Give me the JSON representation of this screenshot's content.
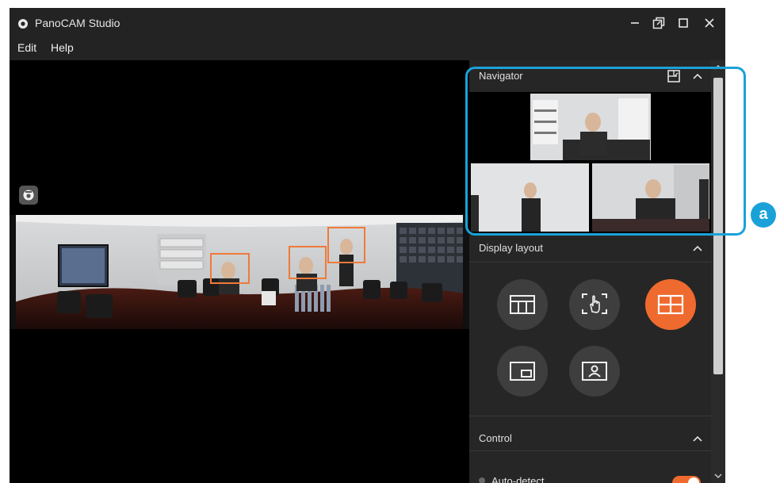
{
  "window": {
    "title": "PanoCAM Studio",
    "controls": [
      "minimize-icon",
      "restore-icon",
      "maximize-icon",
      "close-icon"
    ]
  },
  "menu": {
    "items": [
      {
        "label": "Edit"
      },
      {
        "label": "Help"
      }
    ]
  },
  "panel": {
    "navigator": {
      "title": "Navigator",
      "icons": [
        "fit-icon",
        "chevron-up-icon"
      ]
    },
    "display_layout": {
      "title": "Display layout",
      "options": [
        {
          "icon": "panorama-layout-icon",
          "active": false
        },
        {
          "icon": "manual-select-icon",
          "active": false
        },
        {
          "icon": "grid-layout-icon",
          "active": true
        },
        {
          "icon": "picture-in-picture-icon",
          "active": false
        },
        {
          "icon": "speaker-layout-icon",
          "active": false
        }
      ]
    },
    "control": {
      "title": "Control",
      "auto_detect": {
        "label": "Auto-detect",
        "enabled": true
      }
    }
  },
  "callout": {
    "label": "a"
  },
  "colors": {
    "accent": "#ef6a2e",
    "callout": "#1aa2d8",
    "panel": "#262626",
    "face_box": "#f07a3a"
  }
}
